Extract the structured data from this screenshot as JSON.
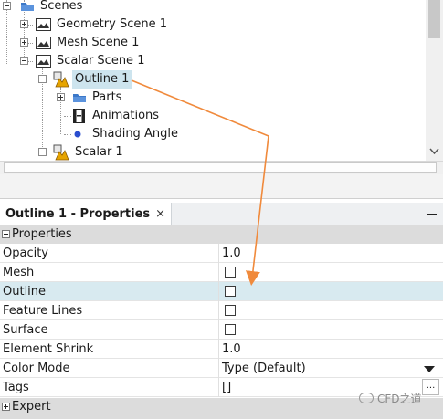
{
  "tree": {
    "items": [
      {
        "label": "Scenes",
        "icon": "folder-icon"
      },
      {
        "label": "Geometry Scene 1",
        "icon": "scene-icon"
      },
      {
        "label": "Mesh Scene 1",
        "icon": "scene-icon"
      },
      {
        "label": "Scalar Scene 1",
        "icon": "scene-icon"
      },
      {
        "label": "Outline 1",
        "icon": "displayer-icon"
      },
      {
        "label": "Parts",
        "icon": "folder-icon"
      },
      {
        "label": "Animations",
        "icon": "animation-icon"
      },
      {
        "label": "Shading Angle",
        "icon": "dot-icon"
      },
      {
        "label": "Scalar 1",
        "icon": "displayer-icon"
      }
    ]
  },
  "properties_panel": {
    "tab_title": "Outline 1 - Properties",
    "close_glyph": "×",
    "group_properties": "Properties",
    "group_expert": "Expert",
    "rows": [
      {
        "name": "Opacity",
        "value": "1.0",
        "type": "text"
      },
      {
        "name": "Mesh",
        "value": false,
        "type": "checkbox"
      },
      {
        "name": "Outline",
        "value": false,
        "type": "checkbox"
      },
      {
        "name": "Feature Lines",
        "value": false,
        "type": "checkbox"
      },
      {
        "name": "Surface",
        "value": false,
        "type": "checkbox"
      },
      {
        "name": "Element Shrink",
        "value": "1.0",
        "type": "text"
      },
      {
        "name": "Color Mode",
        "value": "Type (Default)",
        "type": "dropdown"
      },
      {
        "name": "Tags",
        "value": "[]",
        "type": "text",
        "button": "..."
      }
    ]
  },
  "watermark": "CFD之道",
  "colors": {
    "selection": "#cde4ee",
    "highlight_row": "#d8eaf0",
    "annotation_arrow": "#f08a3c",
    "folder": "#3c78c8"
  }
}
